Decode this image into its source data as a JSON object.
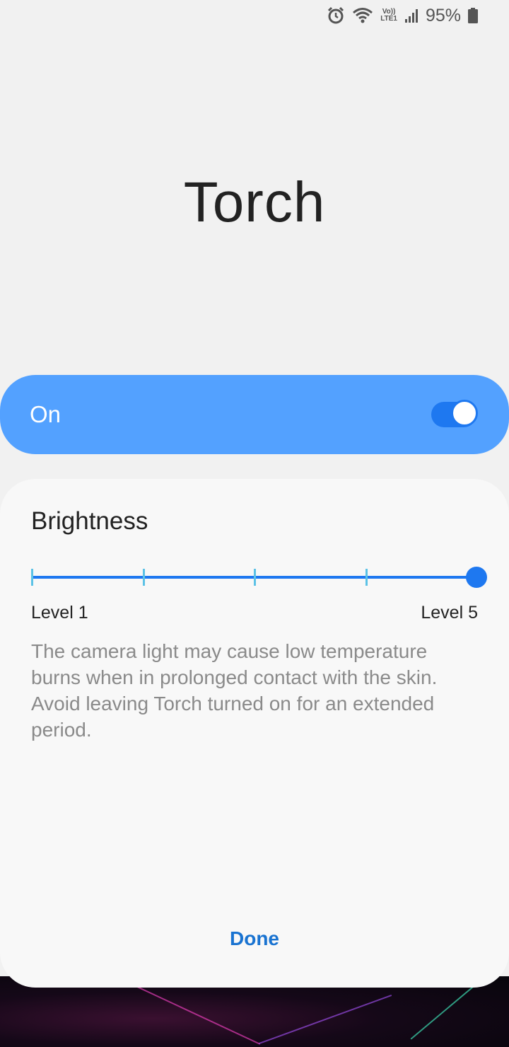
{
  "status_bar": {
    "battery_percent": "95%",
    "icons": [
      "alarm-icon",
      "wifi-icon",
      "volte-lte-icon",
      "signal-icon",
      "battery-icon"
    ],
    "volte_top": "Vo))",
    "volte_bottom": "LTE1"
  },
  "title": "Torch",
  "toggle_row": {
    "label": "On",
    "is_on": true,
    "accent_color": "#53a1ff"
  },
  "brightness": {
    "heading": "Brightness",
    "min_label": "Level 1",
    "max_label": "Level 5",
    "levels": 5,
    "current_level": 5
  },
  "warning": "The camera light may cause low temperature burns when in prolonged contact with the skin. Avoid leaving Torch turned on for an extended period.",
  "done_label": "Done",
  "colors": {
    "slider": "#1e78f0",
    "done": "#1973d1"
  }
}
